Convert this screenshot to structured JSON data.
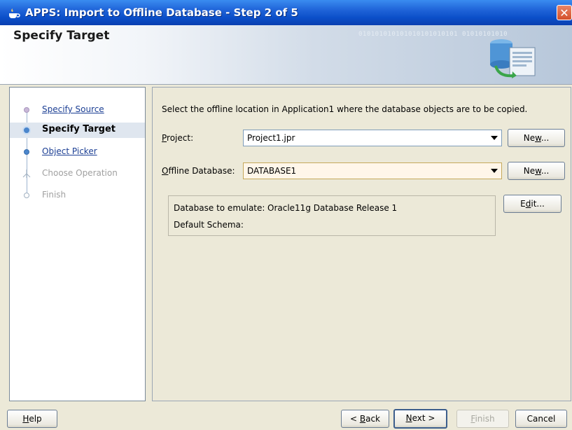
{
  "window": {
    "title": "APPS: Import to Offline Database - Step 2 of 5",
    "close_glyph": "✕"
  },
  "header": {
    "title": "Specify Target",
    "binary_text": "010101010101010101010101 01010101010"
  },
  "nav": {
    "items": [
      {
        "label": "Specify Source",
        "state": "link"
      },
      {
        "label": "Specify Target",
        "state": "current"
      },
      {
        "label": "Object Picker",
        "state": "link"
      },
      {
        "label": "Choose Operation",
        "state": "disabled"
      },
      {
        "label": "Finish",
        "state": "disabled"
      }
    ]
  },
  "content": {
    "instruction": "Select the offline location in Application1 where the database objects are to be copied.",
    "project": {
      "label_mnemonic": "P",
      "label_rest": "roject:",
      "value": "Project1.jpr",
      "new_prefix": "Ne",
      "new_mnemonic": "w",
      "new_suffix": "..."
    },
    "offline_db": {
      "label_mnemonic": "O",
      "label_rest": "ffline Database:",
      "value": "DATABASE1",
      "new_prefix": "Ne",
      "new_mnemonic": "w",
      "new_suffix": "..."
    },
    "info": {
      "emulate_label": "Database to emulate:",
      "emulate_value": "Oracle11g Database Release 1",
      "schema_label": "Default Schema:",
      "schema_value": ""
    },
    "edit_prefix": "E",
    "edit_mnemonic": "d",
    "edit_suffix": "it..."
  },
  "footer": {
    "help_mnemonic": "H",
    "help_rest": "elp",
    "back_prefix": "< ",
    "back_mnemonic": "B",
    "back_rest": "ack",
    "next_mnemonic": "N",
    "next_rest": "ext >",
    "finish_mnemonic": "F",
    "finish_rest": "inish",
    "cancel": "Cancel"
  },
  "colors": {
    "titlebar": "#0b4fc9",
    "link": "#1c3f94",
    "focus_field": "#fff6e9"
  }
}
